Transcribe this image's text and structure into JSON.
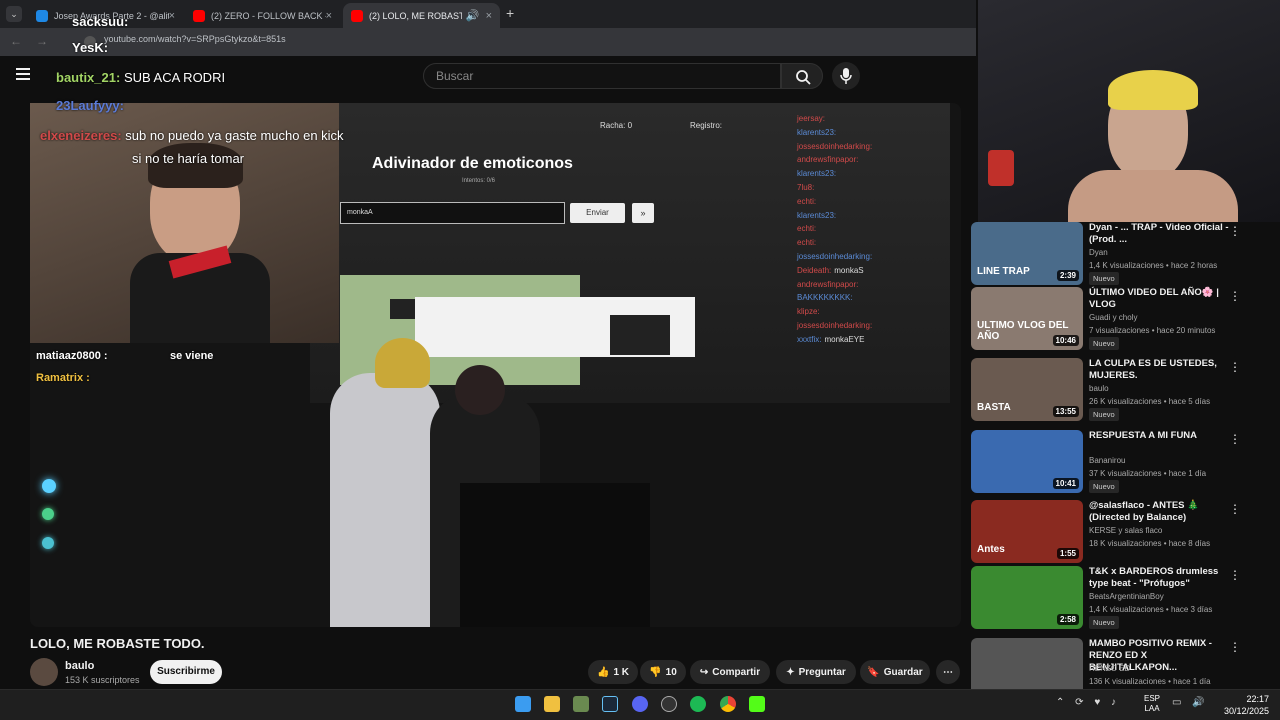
{
  "browser": {
    "tabs": [
      {
        "label": "Josep Awards Parte 2 - @alita"
      },
      {
        "label": "(2) ZERO - FOLLOW BACK - You"
      },
      {
        "label": "(2) LOLO, ME ROBASTE TOD"
      }
    ],
    "url": "youtube.com/watch?v=SRPpsGtykzo&t=851s"
  },
  "youtube": {
    "search_placeholder": "Buscar"
  },
  "overlay": {
    "messages": [
      {
        "user": "sacksuu:",
        "text": ""
      },
      {
        "user": "YesK:",
        "text": ""
      },
      {
        "user": "bautix_21:",
        "text": "SUB ACA RODRI"
      },
      {
        "user": "23Laufyyy:",
        "text": ""
      },
      {
        "user": "elxeneizeres:",
        "text": "sub no puedo ya gaste mucho en kick"
      },
      {
        "user": "",
        "text": "si no te haría tomar"
      },
      {
        "user": "matiaaz0800 :",
        "text": "se viene"
      },
      {
        "user": "Ramatrix :",
        "text": ""
      }
    ]
  },
  "video_content": {
    "game_title": "Adivinador de emoticonos",
    "racha_label": "Racha:",
    "racha_value": "0",
    "registro_label": "Registro:",
    "intentos": "Intentos: 0/6",
    "input_value": "monkaA",
    "enviar": "Enviar",
    "skip": "»",
    "chat": [
      {
        "user": "jeersay:",
        "text": ""
      },
      {
        "user": "klarents23:",
        "text": ""
      },
      {
        "user": "jossesdoinhedarking:",
        "text": ""
      },
      {
        "user": "andrewsfinpapor:",
        "text": ""
      },
      {
        "user": "klarents23:",
        "text": ""
      },
      {
        "user": "7lu8:",
        "text": ""
      },
      {
        "user": "echti:",
        "text": ""
      },
      {
        "user": "klarents23:",
        "text": ""
      },
      {
        "user": "echti:",
        "text": ""
      },
      {
        "user": "echti:",
        "text": ""
      },
      {
        "user": "jossesdoinhedarking:",
        "text": ""
      },
      {
        "user": "Deideath:",
        "text": "monkaS"
      },
      {
        "user": "andrewsfinpapor:",
        "text": ""
      },
      {
        "user": "BAKKKKKKKK:",
        "text": ""
      },
      {
        "user": "klipze:",
        "text": ""
      },
      {
        "user": "jossesdoinhedarking:",
        "text": ""
      },
      {
        "user": "xxxtfix:",
        "text": "monkaEYE"
      }
    ]
  },
  "video": {
    "title": "LOLO, ME ROBASTE TODO.",
    "channel": "baulo",
    "subscribers": "153 K suscriptores",
    "subscribe_label": "Suscribirme",
    "likes": "1 K",
    "dislikes": "10",
    "share_label": "Compartir",
    "ask_label": "Preguntar",
    "save_label": "Guardar"
  },
  "recommendations": [
    {
      "title": "Dyan - ... TRAP - Video Oficial - (Prod. ...",
      "channel": "Dyan",
      "meta": "1,4 K visualizaciones • hace 2 horas",
      "duration": "2:39",
      "new": "Nuevo",
      "thumb_color": "#4a6b8a"
    },
    {
      "title": "ÚLTIMO VIDEO DEL AÑO🌸 | VLOG",
      "channel": "Guadi y choly",
      "meta": "7 visualizaciones • hace 20 minutos",
      "duration": "10:46",
      "new": "Nuevo",
      "thumb_color": "#8a7a70"
    },
    {
      "title": "LA CULPA ES DE USTEDES, MUJERES.",
      "channel": "baulo",
      "meta": "26 K visualizaciones • hace 5 días",
      "duration": "13:55",
      "new": "Nuevo",
      "thumb_color": "#6a5a50"
    },
    {
      "title": "RESPUESTA A MI FUNA",
      "channel": "Bananirou",
      "meta": "37 K visualizaciones • hace 1 día",
      "duration": "10:41",
      "new": "Nuevo",
      "thumb_color": "#3a6ab0"
    },
    {
      "title": "@salasflaco - ANTES 🎄 (Directed by Balance)",
      "channel": "KERSE y salas flaco",
      "meta": "18 K visualizaciones • hace 8 días",
      "duration": "1:55",
      "new": "",
      "thumb_color": "#8a2a20"
    },
    {
      "title": "T&K x BARDEROS drumless type beat - \"Prófugos\"",
      "channel": "BeatsArgentinianBoy",
      "meta": "1,4 K visualizaciones • hace 3 días",
      "duration": "2:58",
      "new": "Nuevo",
      "thumb_color": "#3a8a30"
    },
    {
      "title": "MAMBO POSITIVO REMIX - RENZO ED X BENJITALKAPON...",
      "channel": "RENZO ED",
      "meta": "136 K visualizaciones • hace 1 día",
      "duration": "",
      "new": "",
      "thumb_color": "#555555"
    }
  ],
  "thumb_texts": [
    "LINE TRAP",
    "ULTIMO VLOG DEL AÑO",
    "BASTA",
    "",
    "Antes",
    "",
    ""
  ],
  "taskbar": {
    "lang_top": "ESP",
    "lang_bottom": "LAA",
    "time": "22:17",
    "date": "30/12/2025"
  },
  "colors": {
    "accent": "#ff0000",
    "bg": "#0f0f0f"
  }
}
